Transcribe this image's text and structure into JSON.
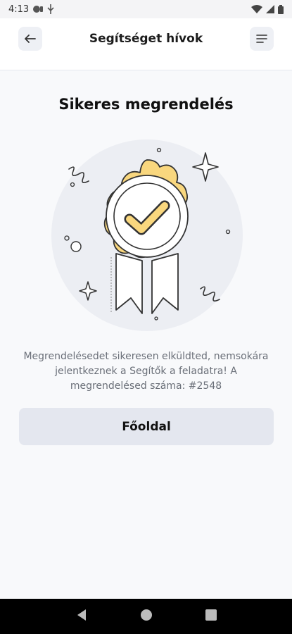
{
  "status_bar": {
    "time": "4:13",
    "icons": [
      "notification-icon",
      "usb-icon",
      "wifi-icon",
      "signal-icon",
      "battery-icon"
    ]
  },
  "header": {
    "title": "Segítséget hívok",
    "back_icon": "arrow-left-icon",
    "menu_icon": "menu-icon"
  },
  "main": {
    "title": "Sikeres megrendelés",
    "illustration": "award-ribbon-checkmark",
    "message": "Megrendelésedet sikeresen elküldted, nemsokára jelentkeznek a Segítők a feladatra! A megrendelésed száma: #2548"
  },
  "actions": {
    "home_button_label": "Főoldal"
  },
  "colors": {
    "accent_yellow": "#f9d77e",
    "button_bg": "#e4e7ef",
    "header_btn_bg": "#eef0f5",
    "background": "#f8f9fb"
  }
}
